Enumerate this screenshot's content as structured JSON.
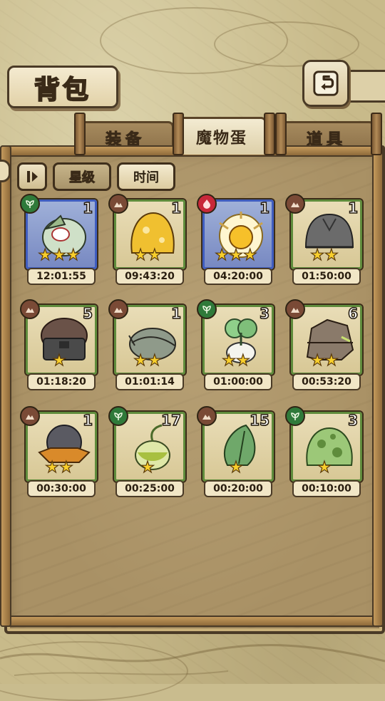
{
  "header": {
    "title": "背包"
  },
  "tabs": [
    {
      "label": "装备",
      "active": false
    },
    {
      "label": "魔物蛋",
      "active": true
    },
    {
      "label": "道具",
      "active": false
    }
  ],
  "filters": {
    "star_label": "星级",
    "time_label": "时间"
  },
  "eggs": [
    {
      "element": "grass",
      "count": "1",
      "stars": 3,
      "time": "12:01:55",
      "frame": "blue"
    },
    {
      "element": "earth",
      "count": "1",
      "stars": 2,
      "time": "09:43:20",
      "frame": "green"
    },
    {
      "element": "fire",
      "count": "1",
      "stars": 3,
      "time": "04:20:00",
      "frame": "blue"
    },
    {
      "element": "earth",
      "count": "1",
      "stars": 2,
      "time": "01:50:00",
      "frame": "green"
    },
    {
      "element": "earth",
      "count": "5",
      "stars": 1,
      "time": "01:18:20",
      "frame": "green"
    },
    {
      "element": "earth",
      "count": "1",
      "stars": 2,
      "time": "01:01:14",
      "frame": "green"
    },
    {
      "element": "grass",
      "count": "3",
      "stars": 2,
      "time": "01:00:00",
      "frame": "green"
    },
    {
      "element": "earth",
      "count": "6",
      "stars": 2,
      "time": "00:53:20",
      "frame": "green"
    },
    {
      "element": "earth",
      "count": "1",
      "stars": 2,
      "time": "00:30:00",
      "frame": "green"
    },
    {
      "element": "grass",
      "count": "17",
      "stars": 1,
      "time": "00:25:00",
      "frame": "green"
    },
    {
      "element": "earth",
      "count": "15",
      "stars": 1,
      "time": "00:20:00",
      "frame": "green"
    },
    {
      "element": "grass",
      "count": "3",
      "stars": 1,
      "time": "00:10:00",
      "frame": "green"
    }
  ],
  "colors": {
    "grass": "#2f7a3a",
    "earth": "#7a4a36",
    "fire": "#c8283a",
    "gold_star": "#f8cf2c"
  }
}
